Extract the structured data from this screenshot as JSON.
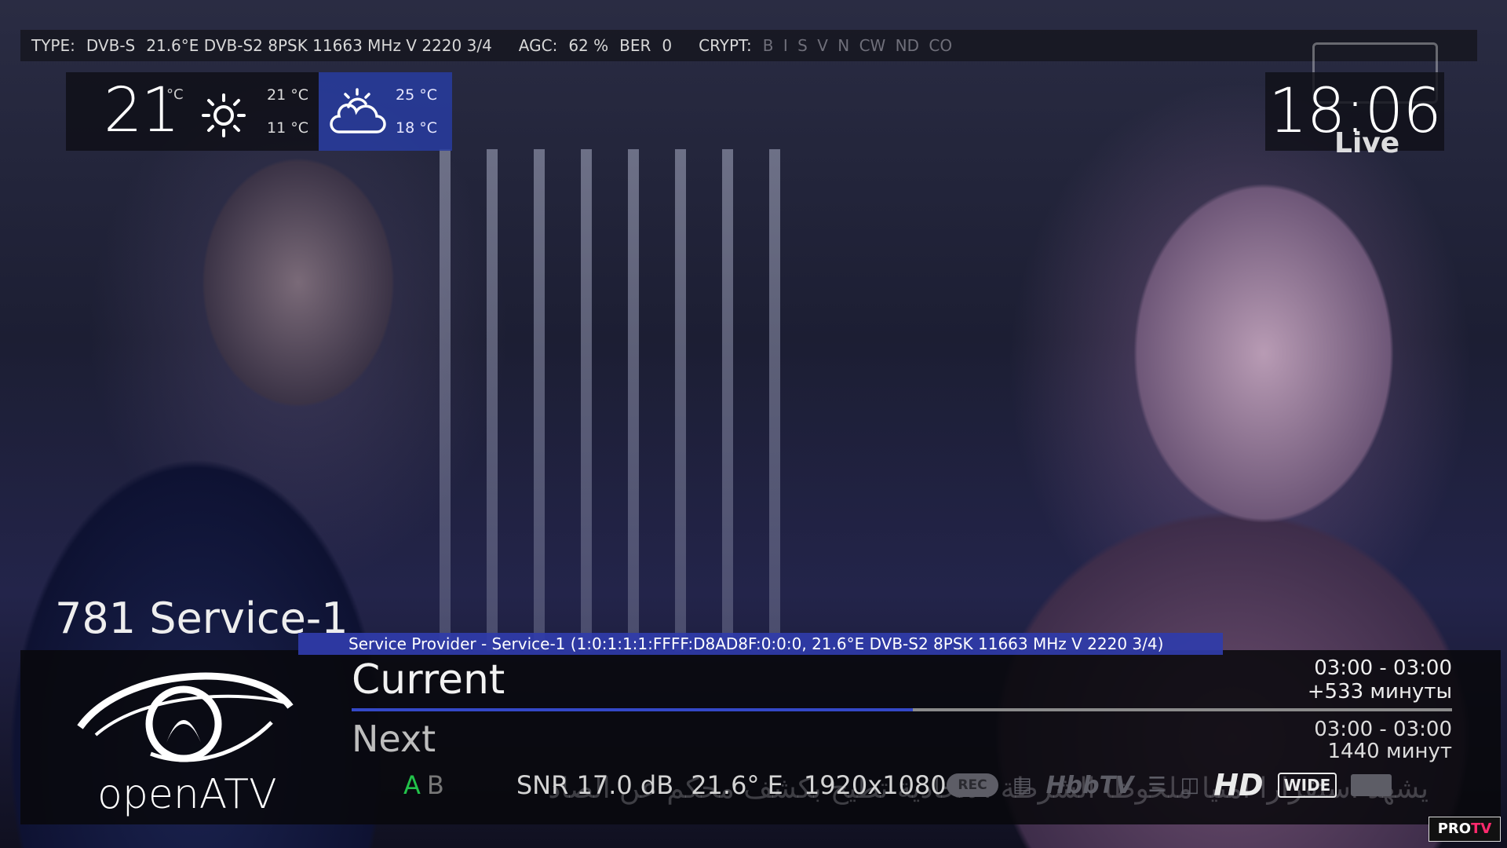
{
  "topbar": {
    "type_label": "TYPE:",
    "type_value": "DVB-S",
    "tuning": "21.6°E DVB-S2 8PSK 11663 MHz V 2220 3/4",
    "agc_label": "AGC:",
    "agc_value": "62 %",
    "ber_label": "BER",
    "ber_value": "0",
    "crypt_label": "CRYPT:",
    "crypt_flags": [
      "B",
      "I",
      "S",
      "V",
      "N",
      "CW",
      "ND",
      "CO"
    ]
  },
  "weather": {
    "current_temp": "21",
    "current_unit": "°C",
    "today_icon": "sun-icon",
    "today_high": "21 °C",
    "today_low": "11 °C",
    "tomorrow_icon": "partly-cloudy-icon",
    "tomorrow_high": "25 °C",
    "tomorrow_low": "18 °C"
  },
  "clock": {
    "time": "18:06",
    "live_label": "Live"
  },
  "service": {
    "name": "781 Service-1",
    "provider_line": "Service Provider - Service-1 (1:0:1:1:1:FFFF:D8AD8F:0:0:0, 21.6°E DVB-S2 8PSK 11663 MHz V 2220 3/4)"
  },
  "logo": {
    "text": "openATV"
  },
  "events": {
    "current_title": "Current",
    "current_time": "03:00  -  03:00",
    "current_remaining": "+533 минуты",
    "current_progress": 0.51,
    "next_title": "Next",
    "next_time": "03:00  -  03:00",
    "next_duration": "1440 минут"
  },
  "status": {
    "audio_a": "A",
    "audio_b": "B",
    "snr": "SNR 17.0 dB",
    "orbital": "21.6° E",
    "resolution": "1920x1080",
    "rec_label": "REC",
    "hbbtv_label": "HbbTV",
    "hd_label": "HD",
    "wide_label": "WIDE"
  },
  "ticker": "يشهد استقرارا امنيا ملحوظا   الشرطة الاتحادية تطيح بكشف محكم عن الصاد",
  "watermark": {
    "pro": "PRO",
    "tv": "TV"
  },
  "colors": {
    "accent_blue": "#3448c8",
    "audio_active": "#22c24a",
    "strip_blue": "#303caa"
  }
}
